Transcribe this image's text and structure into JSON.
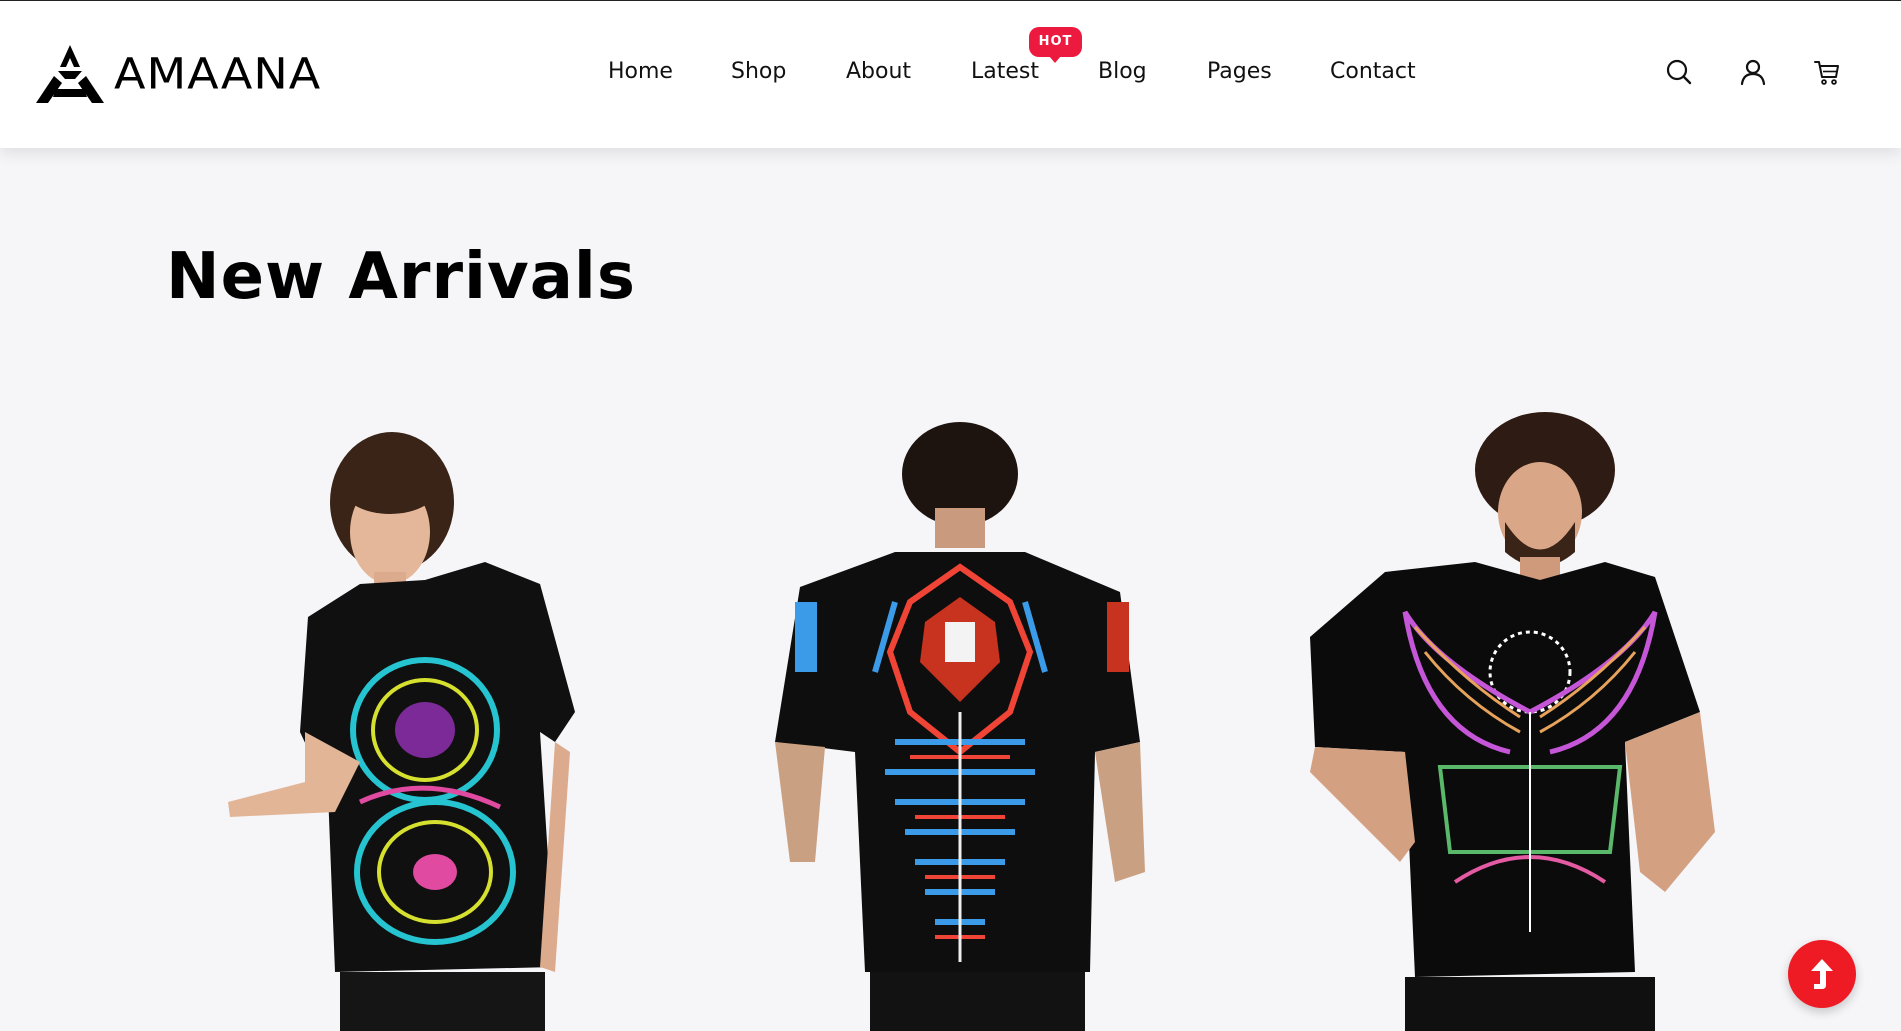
{
  "brand": {
    "name": "AMAANA",
    "logo_icon": "triangle-logo-icon"
  },
  "nav": {
    "items": [
      {
        "label": "Home"
      },
      {
        "label": "Shop"
      },
      {
        "label": "About"
      },
      {
        "label": "Latest",
        "badge": "HOT"
      },
      {
        "label": "Blog"
      },
      {
        "label": "Pages"
      },
      {
        "label": "Contact"
      }
    ]
  },
  "header_icons": [
    "search-icon",
    "user-icon",
    "cart-icon"
  ],
  "section": {
    "title": "New Arrivals"
  },
  "products": [
    {
      "image": "model-front-turquoise-mandala-tee"
    },
    {
      "image": "model-back-cyber-mecha-tee"
    },
    {
      "image": "model-front-neon-wings-tee"
    }
  ],
  "colors": {
    "accent": "#ec1a3e",
    "back_to_top": "#ee1b24",
    "background": "#f6f6f9",
    "header_bg": "#ffffff"
  },
  "back_to_top_icon": "arrow-up-icon"
}
